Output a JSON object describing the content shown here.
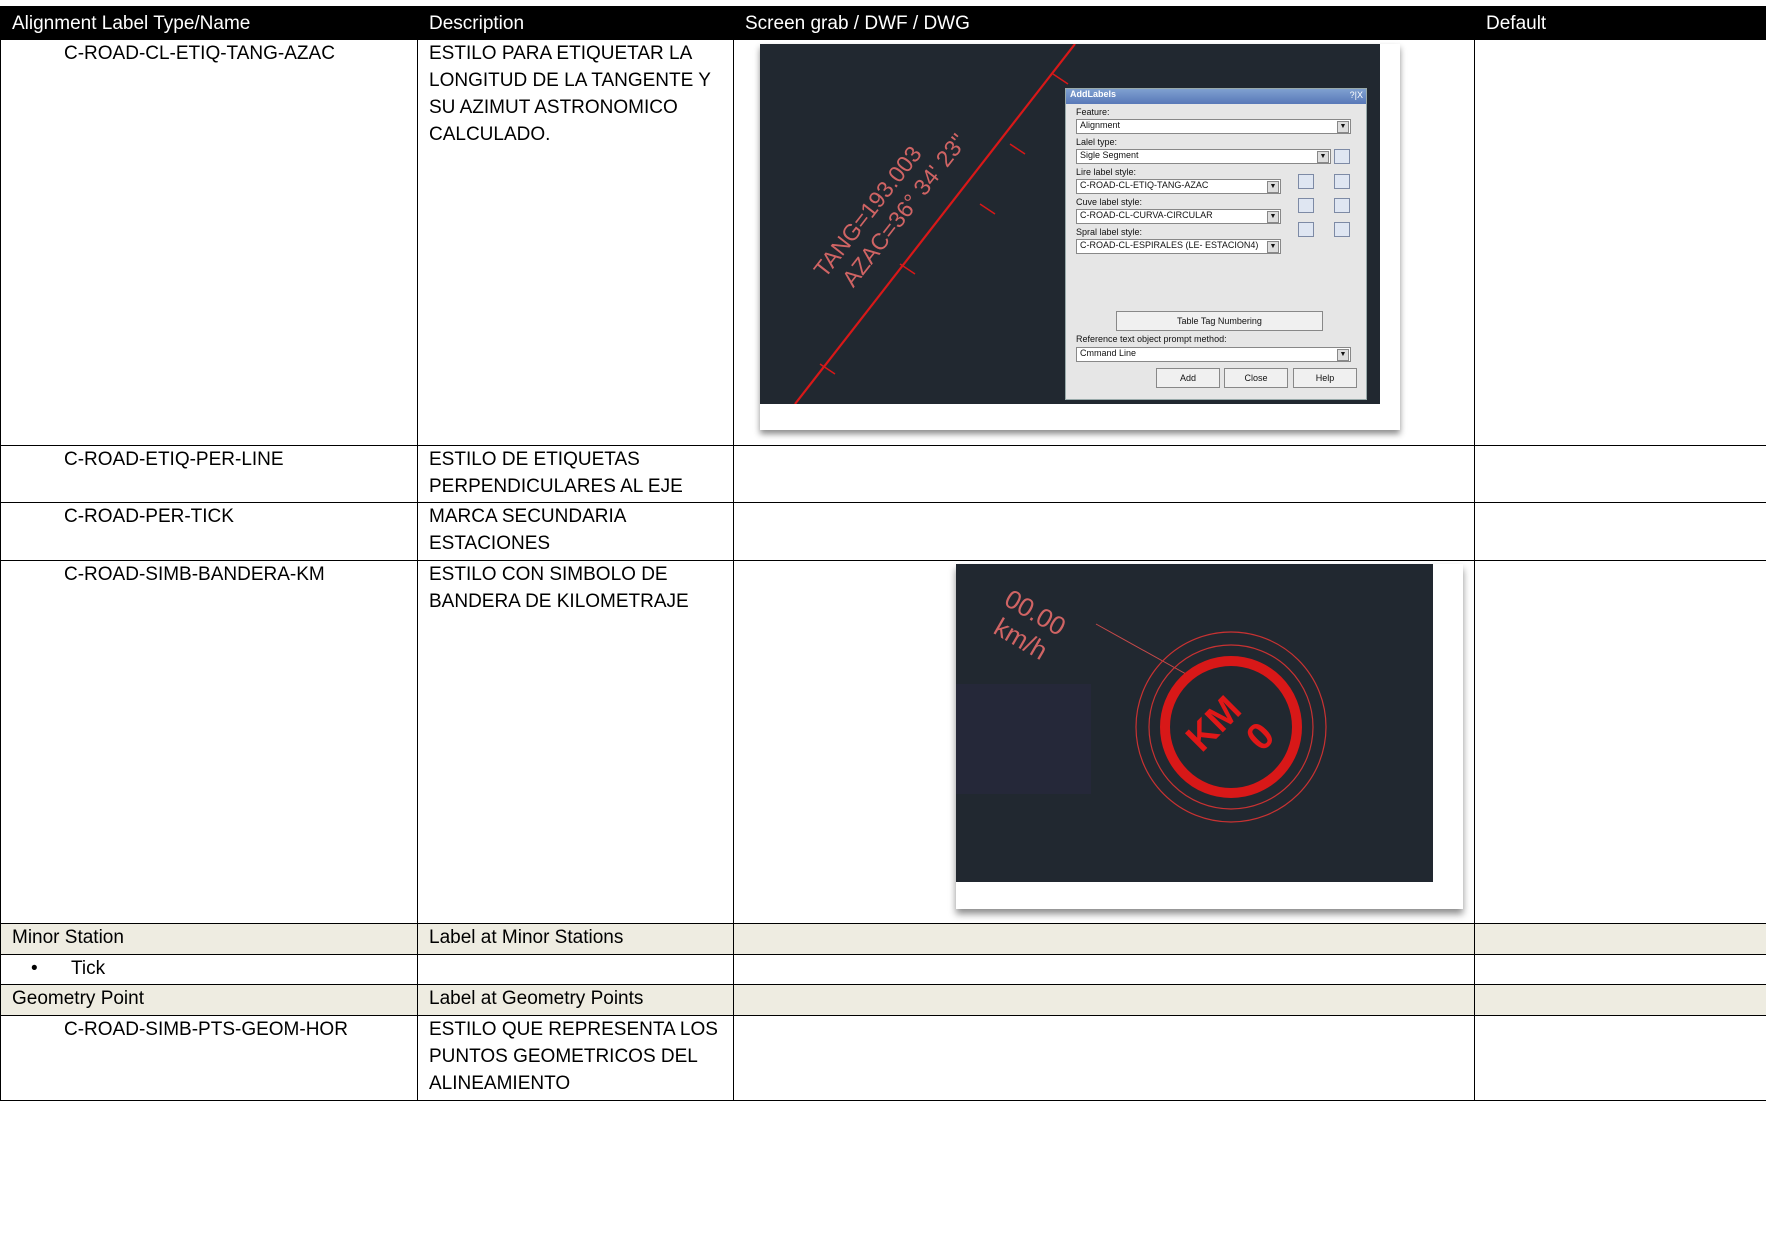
{
  "headers": {
    "col1": "Alignment Label Type/Name",
    "col2": "Description",
    "col3": "Screen grab / DWF / DWG",
    "col4": "Default"
  },
  "rows": {
    "tang": {
      "name": "C-ROAD-CL-ETIQ-TANG-AZAC",
      "desc": "ESTILO PARA ETIQUETAR LA LONGITUD DE LA TANGENTE Y SU AZIMUT ASTRONOMICO CALCULADO."
    },
    "perline": {
      "name": "C-ROAD-ETIQ-PER-LINE",
      "desc": "ESTILO DE ETIQUETAS PERPENDICULARES AL EJE"
    },
    "pertick": {
      "name": "C-ROAD-PER-TICK",
      "desc": "MARCA SECUNDARIA ESTACIONES"
    },
    "bandera": {
      "name": "C-ROAD-SIMB-BANDERA-KM",
      "desc": "ESTILO CON SIMBOLO DE BANDERA DE KILOMETRAJE"
    },
    "minor": {
      "name": "Minor Station",
      "desc": "Label at Minor Stations"
    },
    "tick": {
      "name": "Tick"
    },
    "geom": {
      "name": "Geometry Point",
      "desc": "Label at Geometry Points"
    },
    "ptsgeom": {
      "name": "C-ROAD-SIMB-PTS-GEOM-HOR",
      "desc": "ESTILO QUE REPRESENTA LOS PUNTOS GEOMETRICOS DEL ALINEAMIENTO"
    }
  },
  "cad1": {
    "label_line1": "TANG=193.003",
    "label_line2": "AZAC=36° 34' 23\"",
    "dialog": {
      "title": "AddLabels",
      "controls": "?|X",
      "feature_label": "Feature:",
      "feature_value": "Alignment",
      "label_type_label": "Lalel type:",
      "label_type_value": "Sigle Segment",
      "line_style_label": "Lire label style:",
      "line_style_value": "C-ROAD-CL-ETIQ-TANG-AZAC",
      "curve_style_label": "Cuve label style:",
      "curve_style_value": "C-ROAD-CL-CURVA-CIRCULAR",
      "spiral_style_label": "Spral label style:",
      "spiral_style_value": "C-ROAD-CL-ESPIRALES (LE- ESTACION4)",
      "table_tag_button": "Table Tag Numbering",
      "ref_prompt_label": "Reference text object prompt method:",
      "ref_prompt_value": "Cmmand Line",
      "add_button": "Add",
      "close_button": "Close",
      "help_button": "Help"
    }
  },
  "cad2": {
    "speed_text": "00.00",
    "speed_unit": "km/h",
    "km_text": "KM",
    "zero_text": "0"
  },
  "colors": {
    "cad_bg": "#212830",
    "cad_red": "#d81818",
    "section_bg": "#eeece1"
  }
}
